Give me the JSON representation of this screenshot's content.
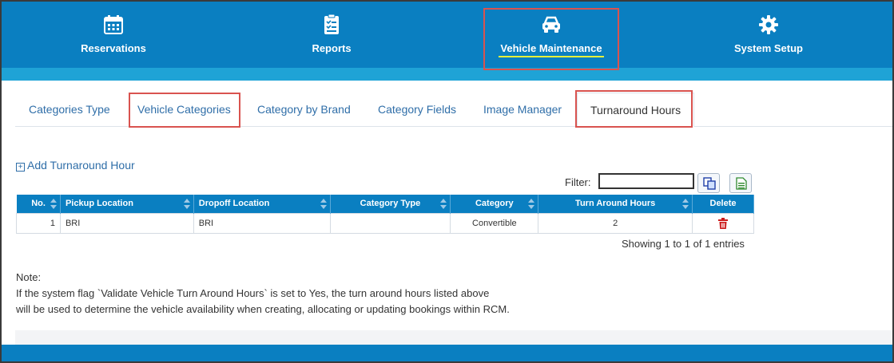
{
  "nav": {
    "items": [
      {
        "label": "Reservations",
        "icon": "calendar-icon"
      },
      {
        "label": "Reports",
        "icon": "checklist-icon"
      },
      {
        "label": "Vehicle Maintenance",
        "icon": "car-icon",
        "active": true
      },
      {
        "label": "System Setup",
        "icon": "gear-icon"
      }
    ]
  },
  "tabs": [
    {
      "label": "Categories Type"
    },
    {
      "label": "Vehicle Categories"
    },
    {
      "label": "Category by Brand"
    },
    {
      "label": "Category Fields"
    },
    {
      "label": "Image Manager"
    },
    {
      "label": "Turnaround Hours",
      "active": true
    }
  ],
  "toolbar": {
    "add_label": "Add Turnaround Hour",
    "filter_label": "Filter:",
    "filter_value": ""
  },
  "table": {
    "columns": [
      "No.",
      "Pickup Location",
      "Dropoff Location",
      "Category Type",
      "Category",
      "Turn Around Hours",
      "Delete"
    ],
    "rows": [
      {
        "no": "1",
        "pickup": "BRI",
        "dropoff": "BRI",
        "category_type": "",
        "category": "Convertible",
        "hours": "2"
      }
    ]
  },
  "footer": {
    "showing": "Showing 1 to 1 of 1 entries"
  },
  "note": {
    "title": "Note:",
    "line1": "If the system flag `Validate Vehicle Turn Around Hours` is set to Yes, the turn around hours listed above",
    "line2": "will be used to determine the vehicle availability when creating, allocating or updating bookings within RCM."
  },
  "colors": {
    "primary": "#0a7fc1",
    "accent_bar": "#1fa3d6",
    "link": "#2f6ea8",
    "highlight_box": "#d9534f",
    "delete_red": "#cc1a1a"
  }
}
